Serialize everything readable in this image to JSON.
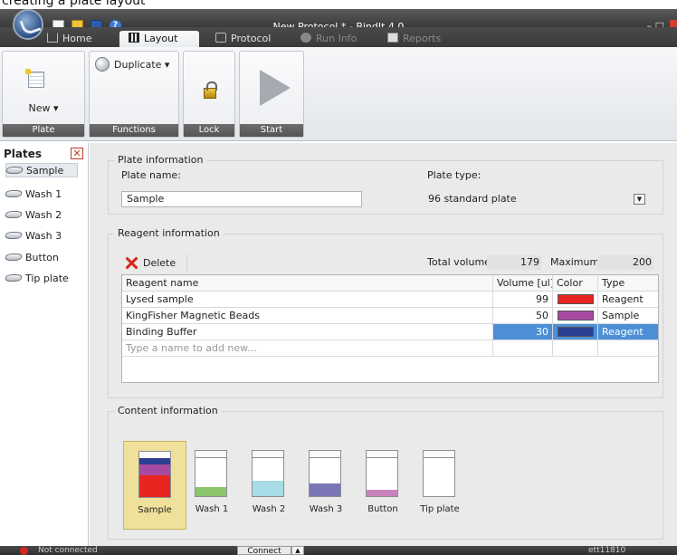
{
  "caption": "creating a plate layout",
  "window": {
    "title": "New Protocol * - BindIt 4.0",
    "controls": "– □"
  },
  "tabs": [
    {
      "label": "Home",
      "icon": "home-icon"
    },
    {
      "label": "Layout",
      "icon": "layout-icon",
      "active": true
    },
    {
      "label": "Protocol",
      "icon": "protocol-icon"
    },
    {
      "label": "Run Info",
      "icon": "info-icon",
      "disabled": true
    },
    {
      "label": "Reports",
      "icon": "report-icon",
      "disabled": true
    }
  ],
  "ribbon": {
    "plate_group": {
      "label": "Plate",
      "new_label": "New ▾"
    },
    "functions_group": {
      "label": "Functions",
      "duplicate_label": "Duplicate  ▾"
    },
    "lock_group": {
      "label": "Lock"
    },
    "start_group": {
      "label": "Start"
    }
  },
  "left_panel": {
    "title": "Plates",
    "items": [
      "Sample",
      "Wash 1",
      "Wash 2",
      "Wash 3",
      "Button",
      "Tip plate"
    ],
    "selected": "Sample"
  },
  "plate_info": {
    "title": "Plate information",
    "name_label": "Plate name:",
    "name_value": "Sample",
    "type_label": "Plate type:",
    "type_value": "96 standard plate"
  },
  "reagent_info": {
    "title": "Reagent information",
    "delete_label": "Delete",
    "total_volume_label": "Total volume:",
    "total_volume": "179",
    "maximum_label": "Maximum:",
    "maximum": "200",
    "columns": [
      "Reagent name",
      "Volume [ul]",
      "Color",
      "Type"
    ],
    "rows": [
      {
        "name": "Lysed sample",
        "volume": "99",
        "color": "#e8251f",
        "type": "Reagent"
      },
      {
        "name": "KingFisher Magnetic Beads",
        "volume": "50",
        "color": "#a54aa0",
        "type": "Sample"
      },
      {
        "name": "Binding Buffer",
        "volume": "30",
        "color": "#2c3f93",
        "type": "Reagent",
        "selected": true
      }
    ],
    "new_row_placeholder": "Type a name to add new..."
  },
  "content_info": {
    "title": "Content information",
    "plates": [
      {
        "name": "Sample",
        "selected": true,
        "layers": [
          {
            "color": "#e8251f",
            "fraction": 0.55
          },
          {
            "color": "#a54aa0",
            "fraction": 0.28
          },
          {
            "color": "#2c3f93",
            "fraction": 0.17
          }
        ]
      },
      {
        "name": "Wash 1",
        "layers": [
          {
            "color": "#8cc66c",
            "fraction": 0.24
          }
        ]
      },
      {
        "name": "Wash 2",
        "layers": [
          {
            "color": "#a8dce6",
            "fraction": 0.4
          }
        ]
      },
      {
        "name": "Wash 3",
        "layers": [
          {
            "color": "#7a76b6",
            "fraction": 0.32
          }
        ]
      },
      {
        "name": "Button",
        "layers": [
          {
            "color": "#c782bb",
            "fraction": 0.16
          }
        ]
      },
      {
        "name": "Tip plate",
        "layers": []
      }
    ]
  },
  "status": {
    "connection": "Not connected",
    "connect_label": "Connect",
    "right_text": "ett11810"
  }
}
